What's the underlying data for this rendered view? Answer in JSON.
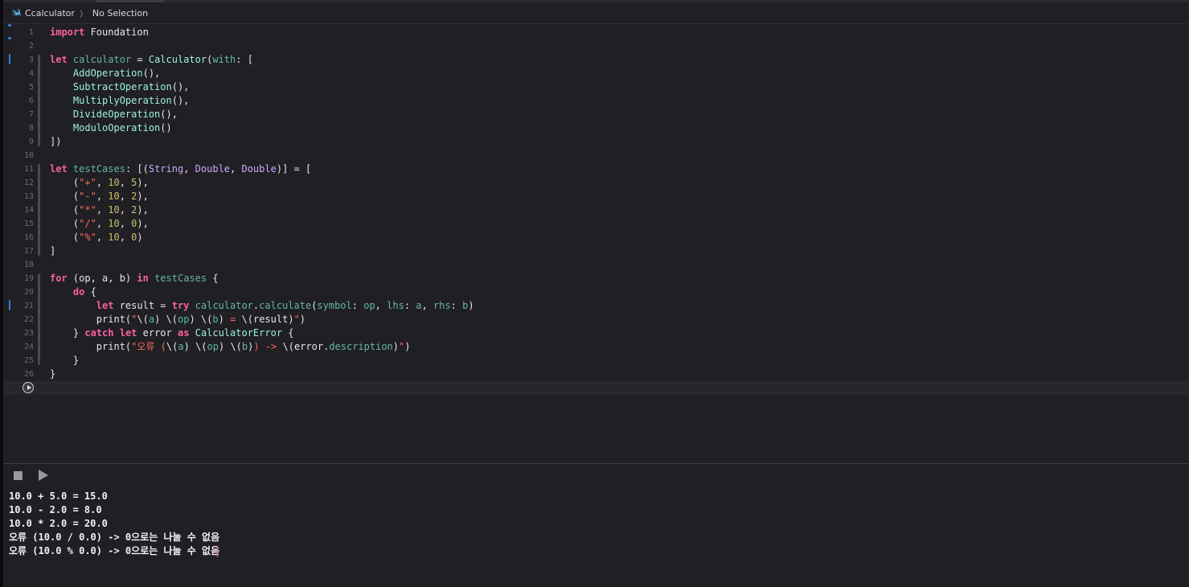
{
  "jumpbar": {
    "project": "Ccalculator",
    "separator": "〉",
    "selection": "No Selection"
  },
  "editor": {
    "lines": [
      {
        "n": "1",
        "tokens": [
          [
            "kw",
            "import"
          ],
          [
            "pl",
            " Foundation"
          ]
        ]
      },
      {
        "n": "2",
        "tokens": []
      },
      {
        "n": "3",
        "tokens": [
          [
            "kw",
            "let"
          ],
          [
            "pl",
            " "
          ],
          [
            "vr",
            "calculator"
          ],
          [
            "pl",
            " = "
          ],
          [
            "cl",
            "Calculator"
          ],
          [
            "pl",
            "("
          ],
          [
            "vr",
            "with"
          ],
          [
            "pl",
            ": ["
          ]
        ]
      },
      {
        "n": "4",
        "tokens": [
          [
            "pl",
            "    "
          ],
          [
            "cl",
            "AddOperation"
          ],
          [
            "pl",
            "(),"
          ]
        ]
      },
      {
        "n": "5",
        "tokens": [
          [
            "pl",
            "    "
          ],
          [
            "cl",
            "SubtractOperation"
          ],
          [
            "pl",
            "(),"
          ]
        ]
      },
      {
        "n": "6",
        "tokens": [
          [
            "pl",
            "    "
          ],
          [
            "cl",
            "MultiplyOperation"
          ],
          [
            "pl",
            "(),"
          ]
        ]
      },
      {
        "n": "7",
        "tokens": [
          [
            "pl",
            "    "
          ],
          [
            "cl",
            "DivideOperation"
          ],
          [
            "pl",
            "(),"
          ]
        ]
      },
      {
        "n": "8",
        "tokens": [
          [
            "pl",
            "    "
          ],
          [
            "cl",
            "ModuloOperation"
          ],
          [
            "pl",
            "()"
          ]
        ]
      },
      {
        "n": "9",
        "tokens": [
          [
            "pl",
            "])"
          ]
        ]
      },
      {
        "n": "10",
        "tokens": []
      },
      {
        "n": "11",
        "tokens": [
          [
            "kw",
            "let"
          ],
          [
            "pl",
            " "
          ],
          [
            "vr",
            "testCases"
          ],
          [
            "pl",
            ": [("
          ],
          [
            "ty",
            "String"
          ],
          [
            "pl",
            ", "
          ],
          [
            "ty",
            "Double"
          ],
          [
            "pl",
            ", "
          ],
          [
            "ty",
            "Double"
          ],
          [
            "pl",
            ")] = ["
          ]
        ]
      },
      {
        "n": "12",
        "tokens": [
          [
            "pl",
            "    ("
          ],
          [
            "st",
            "\"+\""
          ],
          [
            "pl",
            ", "
          ],
          [
            "nm",
            "10"
          ],
          [
            "pl",
            ", "
          ],
          [
            "nm",
            "5"
          ],
          [
            "pl",
            "),"
          ]
        ]
      },
      {
        "n": "13",
        "tokens": [
          [
            "pl",
            "    ("
          ],
          [
            "st",
            "\"-\""
          ],
          [
            "pl",
            ", "
          ],
          [
            "nm",
            "10"
          ],
          [
            "pl",
            ", "
          ],
          [
            "nm",
            "2"
          ],
          [
            "pl",
            "),"
          ]
        ]
      },
      {
        "n": "14",
        "tokens": [
          [
            "pl",
            "    ("
          ],
          [
            "st",
            "\"*\""
          ],
          [
            "pl",
            ", "
          ],
          [
            "nm",
            "10"
          ],
          [
            "pl",
            ", "
          ],
          [
            "nm",
            "2"
          ],
          [
            "pl",
            "),"
          ]
        ]
      },
      {
        "n": "15",
        "tokens": [
          [
            "pl",
            "    ("
          ],
          [
            "st",
            "\"/\""
          ],
          [
            "pl",
            ", "
          ],
          [
            "nm",
            "10"
          ],
          [
            "pl",
            ", "
          ],
          [
            "nm",
            "0"
          ],
          [
            "pl",
            "),"
          ]
        ]
      },
      {
        "n": "16",
        "tokens": [
          [
            "pl",
            "    ("
          ],
          [
            "st",
            "\"%\""
          ],
          [
            "pl",
            ", "
          ],
          [
            "nm",
            "10"
          ],
          [
            "pl",
            ", "
          ],
          [
            "nm",
            "0"
          ],
          [
            "pl",
            ")"
          ]
        ]
      },
      {
        "n": "17",
        "tokens": [
          [
            "pl",
            "]"
          ]
        ]
      },
      {
        "n": "18",
        "tokens": []
      },
      {
        "n": "19",
        "tokens": [
          [
            "kw",
            "for"
          ],
          [
            "pl",
            " (op, a, b) "
          ],
          [
            "kw",
            "in"
          ],
          [
            "pl",
            " "
          ],
          [
            "vr",
            "testCases"
          ],
          [
            "pl",
            " {"
          ]
        ]
      },
      {
        "n": "20",
        "tokens": [
          [
            "pl",
            "    "
          ],
          [
            "kw",
            "do"
          ],
          [
            "pl",
            " {"
          ]
        ]
      },
      {
        "n": "21",
        "tokens": [
          [
            "pl",
            "        "
          ],
          [
            "kw",
            "let"
          ],
          [
            "pl",
            " result = "
          ],
          [
            "kw",
            "try"
          ],
          [
            "pl",
            " "
          ],
          [
            "vr",
            "calculator"
          ],
          [
            "pl",
            "."
          ],
          [
            "vr",
            "calculate"
          ],
          [
            "pl",
            "("
          ],
          [
            "vr",
            "symbol"
          ],
          [
            "pl",
            ": "
          ],
          [
            "vr",
            "op"
          ],
          [
            "pl",
            ", "
          ],
          [
            "vr",
            "lhs"
          ],
          [
            "pl",
            ": "
          ],
          [
            "vr",
            "a"
          ],
          [
            "pl",
            ", "
          ],
          [
            "vr",
            "rhs"
          ],
          [
            "pl",
            ": "
          ],
          [
            "vr",
            "b"
          ],
          [
            "pl",
            ")"
          ]
        ]
      },
      {
        "n": "22",
        "tokens": [
          [
            "pl",
            "        print("
          ],
          [
            "st",
            "\""
          ],
          [
            "pl",
            "\\("
          ],
          [
            "vr",
            "a"
          ],
          [
            "pl",
            ")"
          ],
          [
            "st",
            " "
          ],
          [
            "pl",
            "\\("
          ],
          [
            "vr",
            "op"
          ],
          [
            "pl",
            ")"
          ],
          [
            "st",
            " "
          ],
          [
            "pl",
            "\\("
          ],
          [
            "vr",
            "b"
          ],
          [
            "pl",
            ")"
          ],
          [
            "st",
            " = "
          ],
          [
            "pl",
            "\\(result)"
          ],
          [
            "st",
            "\""
          ],
          [
            "pl",
            ")"
          ]
        ]
      },
      {
        "n": "23",
        "tokens": [
          [
            "pl",
            "    } "
          ],
          [
            "kw",
            "catch"
          ],
          [
            "pl",
            " "
          ],
          [
            "kw",
            "let"
          ],
          [
            "pl",
            " error "
          ],
          [
            "kw",
            "as"
          ],
          [
            "pl",
            " "
          ],
          [
            "cl",
            "CalculatorError"
          ],
          [
            "pl",
            " {"
          ]
        ]
      },
      {
        "n": "24",
        "tokens": [
          [
            "pl",
            "        print("
          ],
          [
            "st",
            "\"오류 ("
          ],
          [
            "pl",
            "\\("
          ],
          [
            "vr",
            "a"
          ],
          [
            "pl",
            ")"
          ],
          [
            "st",
            " "
          ],
          [
            "pl",
            "\\("
          ],
          [
            "vr",
            "op"
          ],
          [
            "pl",
            ")"
          ],
          [
            "st",
            " "
          ],
          [
            "pl",
            "\\("
          ],
          [
            "vr",
            "b"
          ],
          [
            "pl",
            ")"
          ],
          [
            "st",
            ") -> "
          ],
          [
            "pl",
            "\\(error."
          ],
          [
            "vr",
            "description"
          ],
          [
            "pl",
            ")"
          ],
          [
            "st",
            "\""
          ],
          [
            "pl",
            ")"
          ]
        ]
      },
      {
        "n": "25",
        "tokens": [
          [
            "pl",
            "    }"
          ]
        ]
      },
      {
        "n": "26",
        "tokens": [
          [
            "pl",
            "}"
          ]
        ]
      }
    ]
  },
  "console": {
    "output": [
      "10.0 + 5.0 = 15.0",
      "10.0 - 2.0 = 8.0",
      "10.0 * 2.0 = 20.0",
      "오류 (10.0 / 0.0) -> 0으로는 나눌 수 없음",
      "오류 (10.0 % 0.0) -> 0으로는 나눌 수 없음"
    ]
  },
  "colors": {
    "background": "#1f1f24",
    "keyword": "#fc5fa3",
    "type": "#d0a8ff",
    "variable": "#67b7a4",
    "class": "#9ef1dd",
    "string": "#fc6a5d",
    "number": "#d0bf69",
    "change_marker": "#2f7dd8"
  },
  "icons": {
    "file": "swift-icon",
    "run_line": "play-circle-icon",
    "stop": "stop-icon",
    "play": "play-icon"
  }
}
